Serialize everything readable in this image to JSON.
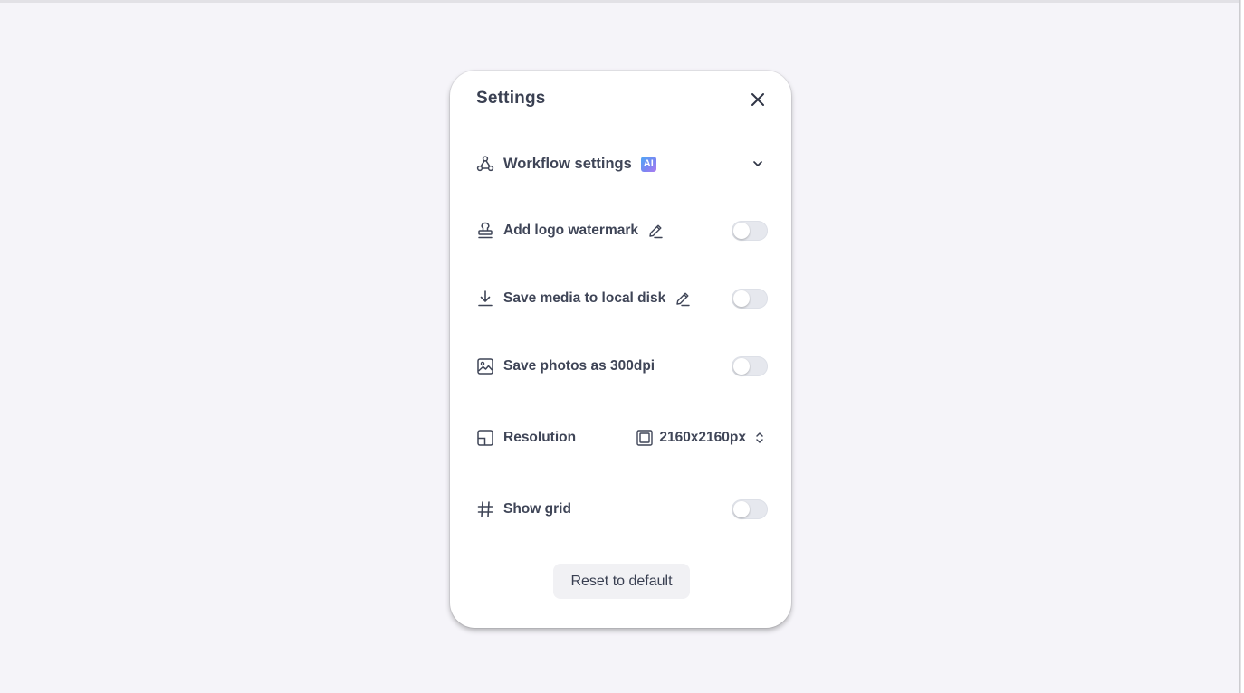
{
  "settings": {
    "title": "Settings",
    "workflow": {
      "label": "Workflow settings",
      "badge": "AI",
      "icon": "workflow-icon",
      "expanded": false
    },
    "logo_watermark": {
      "label": "Add logo watermark",
      "icon": "stamp-icon",
      "enabled": false
    },
    "save_media": {
      "label": "Save media to local disk",
      "icon": "download-icon",
      "enabled": false
    },
    "save_photos_dpi": {
      "label": "Save photos as 300dpi",
      "icon": "image-icon",
      "enabled": false
    },
    "resolution": {
      "label": "Resolution",
      "icon": "layout-icon",
      "value": "2160x2160px"
    },
    "show_grid": {
      "label": "Show grid",
      "icon": "hash-icon",
      "enabled": false
    },
    "reset_label": "Reset to default"
  },
  "colors": {
    "background": "#f5f4f9",
    "text": "#3f4557",
    "toggle_off": "#e6e8ee",
    "ai_badge_from": "#4fa8f6",
    "ai_badge_to": "#b07cf0"
  }
}
